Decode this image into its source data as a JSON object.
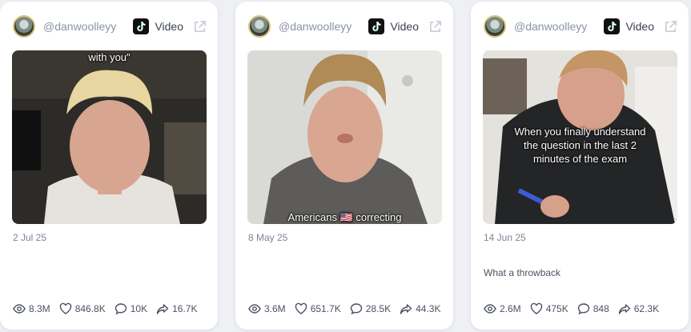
{
  "cards": [
    {
      "handle": "@danwoolleyy",
      "type": "Video",
      "caption": "with you\"",
      "date": "2 Jul 25",
      "description": "",
      "views": "8.3M",
      "likes": "846.8K",
      "comments": "10K",
      "shares": "16.7K"
    },
    {
      "handle": "@danwoolleyy",
      "type": "Video",
      "caption": "Americans 🇺🇸 correcting",
      "date": "8 May 25",
      "description": "",
      "views": "3.6M",
      "likes": "651.7K",
      "comments": "28.5K",
      "shares": "44.3K"
    },
    {
      "handle": "@danwoolleyy",
      "type": "Video",
      "caption": "When you finally understand\nthe question in the last 2\nminutes of the exam",
      "date": "14 Jun 25",
      "description": "What a throwback",
      "views": "2.6M",
      "likes": "475K",
      "comments": "848",
      "shares": "62.3K"
    }
  ],
  "icons": {
    "platform": "tiktok-icon",
    "external": "external-link-icon",
    "views": "eye-icon",
    "likes": "heart-icon",
    "comments": "comment-icon",
    "shares": "share-icon"
  },
  "colors": {
    "page_bg": "#eef0f4",
    "card_bg": "#ffffff",
    "muted_text": "#8a93a6"
  }
}
